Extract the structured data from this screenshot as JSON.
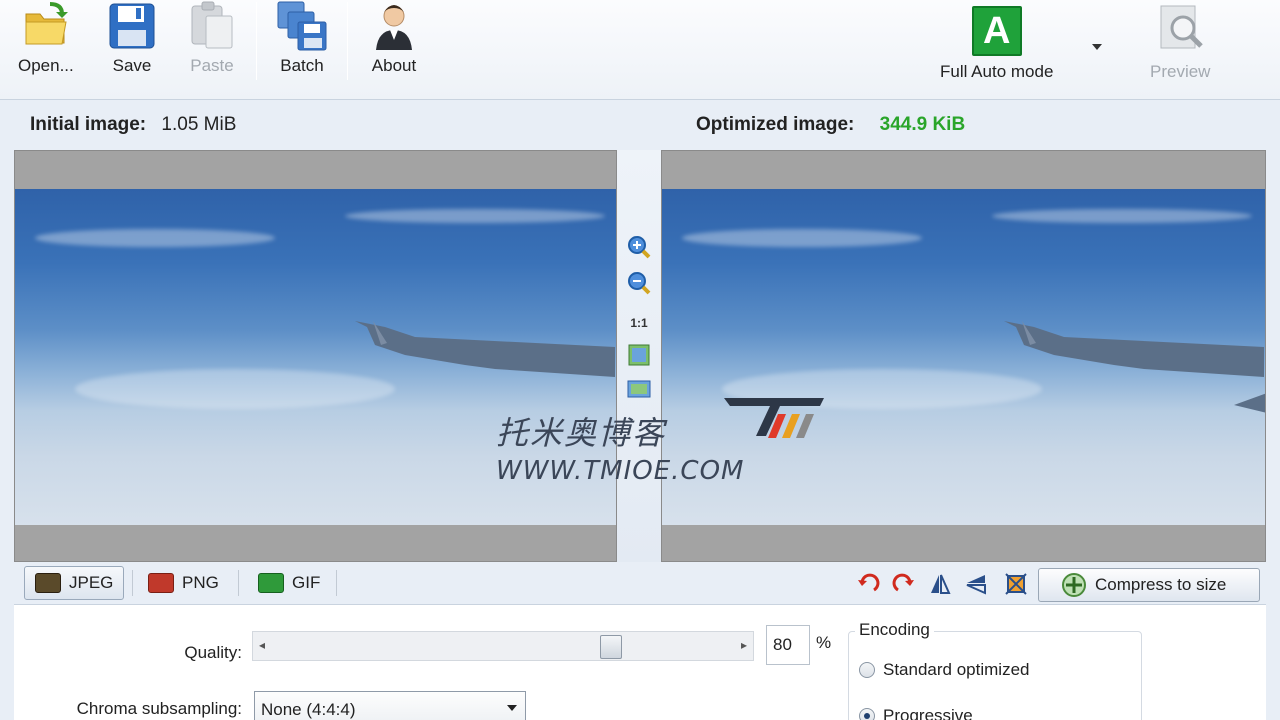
{
  "toolbar": {
    "open_label": "Open...",
    "save_label": "Save",
    "paste_label": "Paste",
    "batch_label": "Batch",
    "about_label": "About",
    "auto_mode_label": "Full Auto mode",
    "auto_mode_icon_letter": "A",
    "preview_label": "Preview"
  },
  "info": {
    "initial_label": "Initial image:",
    "initial_value": "1.05 MiB",
    "optimized_label": "Optimized image:",
    "optimized_value": "344.9 KiB"
  },
  "zoom": {
    "one_to_one": "1:1"
  },
  "formats": {
    "jpeg": "JPEG",
    "png": "PNG",
    "gif": "GIF"
  },
  "actions": {
    "compress_label": "Compress to size"
  },
  "settings": {
    "quality_label": "Quality:",
    "quality_value": "80",
    "quality_unit": "%",
    "quality_fraction": 0.75,
    "chroma_label": "Chroma subsampling:",
    "chroma_value": "None (4:4:4)",
    "encoding_title": "Encoding",
    "encoding_standard": "Standard optimized",
    "encoding_progressive": "Progressive"
  },
  "watermark": {
    "chinese": "托米奥博客",
    "url": "WWW.TMIOE.COM"
  },
  "colors": {
    "accent_green": "#2aa52a",
    "auto_mode_bg": "#1fa23a"
  }
}
